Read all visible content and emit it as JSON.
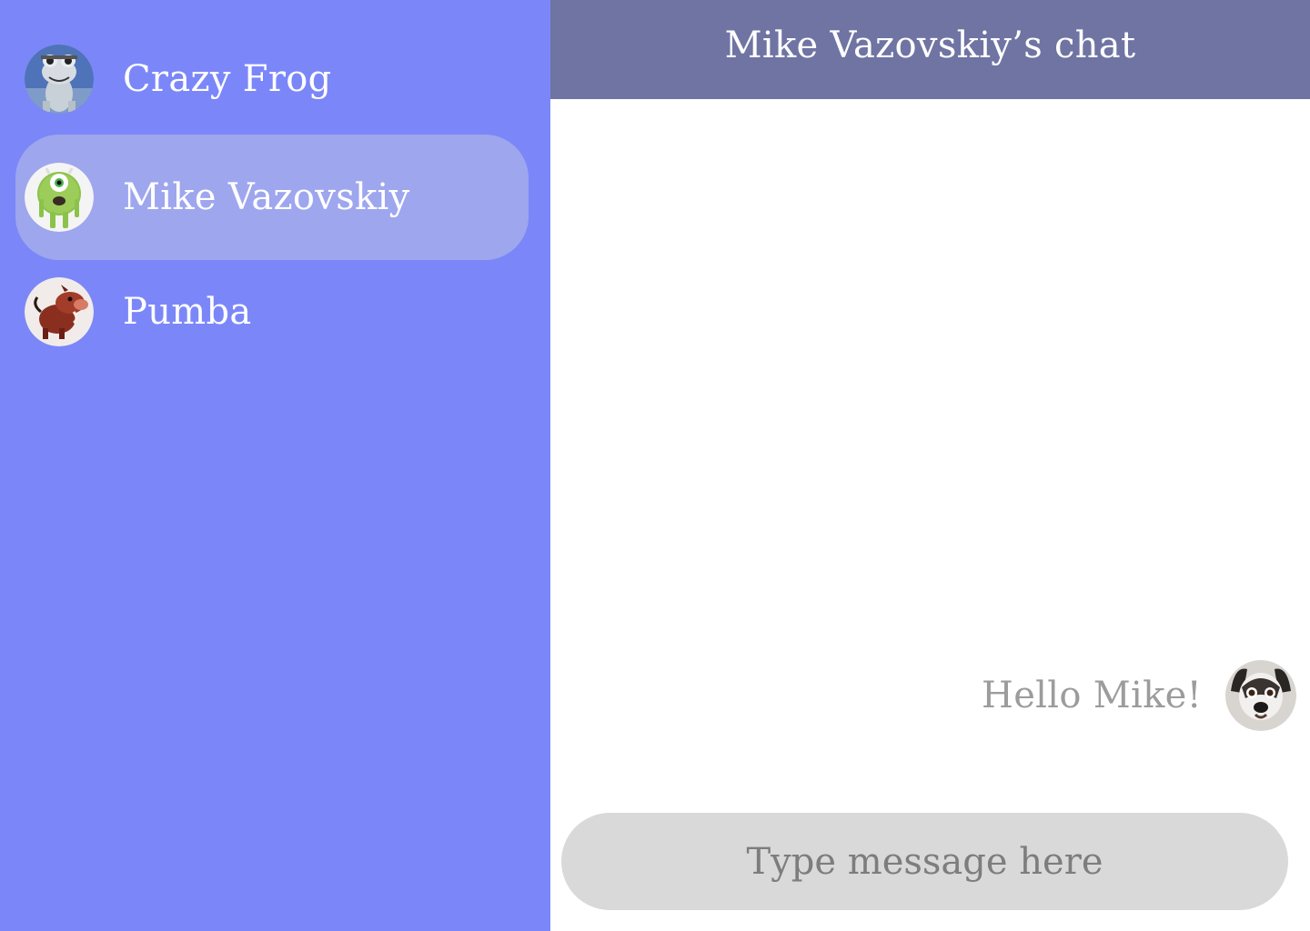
{
  "sidebar": {
    "contacts": [
      {
        "name": "Crazy Frog",
        "avatar_icon": "crazy-frog-avatar",
        "active": false
      },
      {
        "name": "Mike Vazovskiy",
        "avatar_icon": "mike-wazowski-avatar",
        "active": true
      },
      {
        "name": "Pumba",
        "avatar_icon": "pumbaa-avatar",
        "active": false
      }
    ]
  },
  "chat": {
    "title": "Mike Vazovskiy’s chat",
    "messages": [
      {
        "text": "Hello Mike!",
        "avatar_icon": "dog-avatar",
        "outgoing": true
      }
    ],
    "composer": {
      "placeholder": "Type message here",
      "value": ""
    }
  },
  "colors": {
    "sidebar_bg": "#7b87f8",
    "active_contact_bg": "#9ea6ee",
    "header_bg": "#6f74a3",
    "composer_bg": "#d9d9d9",
    "message_text": "#9c9c9c"
  }
}
